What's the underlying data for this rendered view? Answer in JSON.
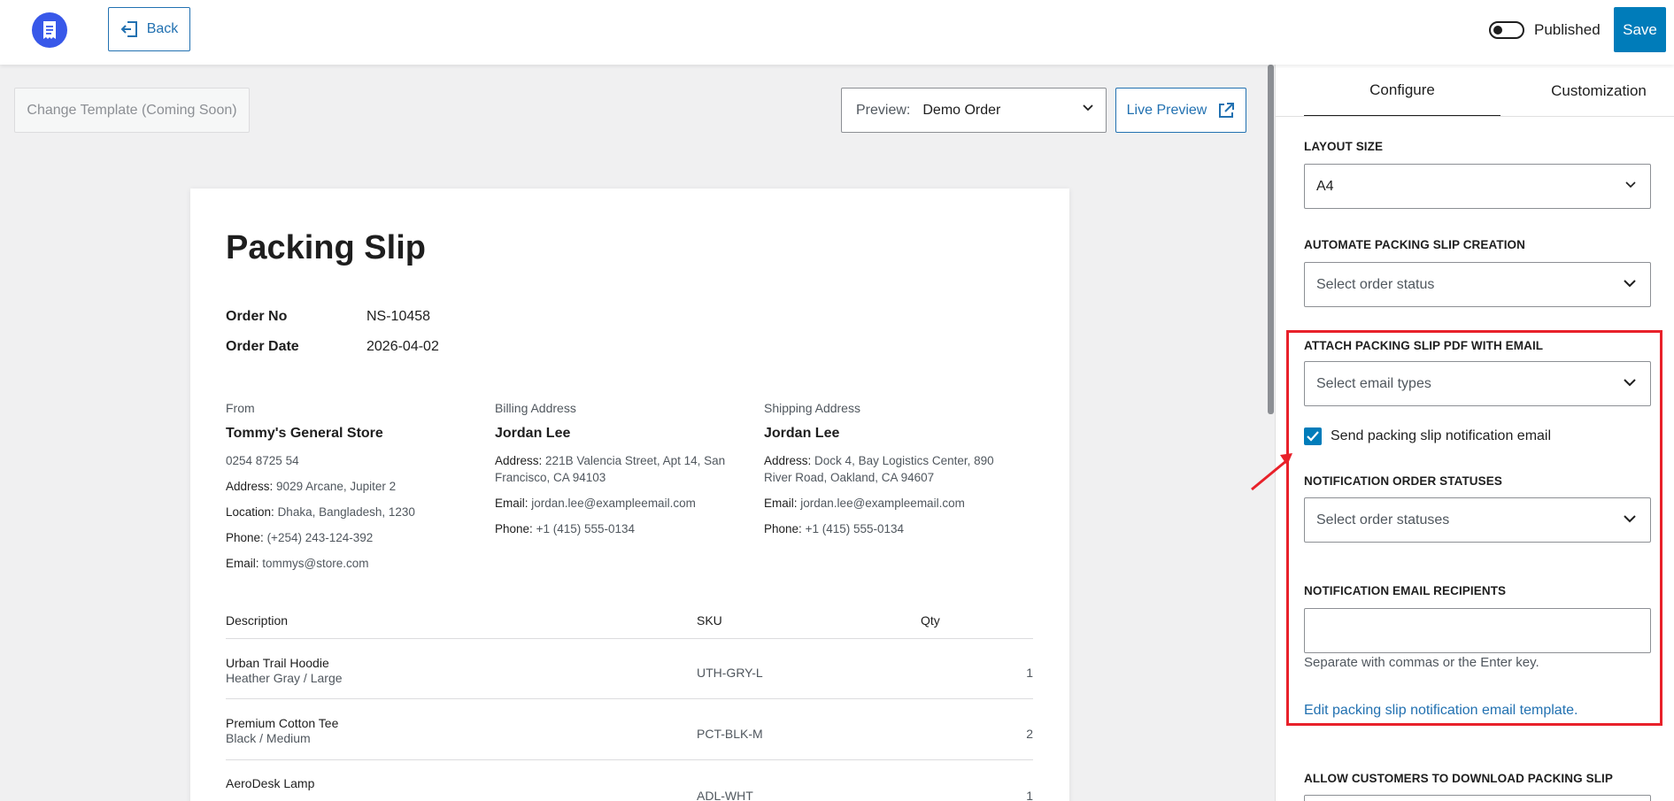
{
  "topbar": {
    "back_label": "Back",
    "status_label": "Published",
    "published": false,
    "save_label": "Save"
  },
  "toolbar": {
    "change_template_label": "Change Template (Coming Soon)",
    "preview_label": "Preview:",
    "preview_value": "Demo Order",
    "live_preview_label": "Live Preview"
  },
  "document": {
    "title": "Packing Slip",
    "order_no_label": "Order No",
    "order_no": "NS-10458",
    "order_date_label": "Order Date",
    "order_date": "2026-04-02",
    "from": {
      "heading": "From",
      "name": "Tommy's General Store",
      "phone_top": "0254 8725 54",
      "address_key": "Address:",
      "address": "9029 Arcane, Jupiter 2",
      "location_key": "Location:",
      "location": "Dhaka, Bangladesh, 1230",
      "phone_key": "Phone:",
      "phone": "(+254) 243-124-392",
      "email_key": "Email:",
      "email": "tommys@store.com"
    },
    "billing": {
      "heading": "Billing Address",
      "name": "Jordan Lee",
      "address_key": "Address:",
      "address": "221B Valencia Street, Apt 14, San Francisco, CA 94103",
      "email_key": "Email:",
      "email": "jordan.lee@exampleemail.com",
      "phone_key": "Phone:",
      "phone": "+1 (415) 555-0134"
    },
    "shipping": {
      "heading": "Shipping Address",
      "name": "Jordan Lee",
      "address_key": "Address:",
      "address": "Dock 4, Bay Logistics Center, 890 River Road, Oakland, CA 94607",
      "email_key": "Email:",
      "email": "jordan.lee@exampleemail.com",
      "phone_key": "Phone:",
      "phone": "+1 (415) 555-0134"
    },
    "table": {
      "headers": [
        "Description",
        "SKU",
        "Qty"
      ],
      "rows": [
        {
          "name": "Urban Trail Hoodie",
          "variant": "Heather Gray / Large",
          "sku": "UTH-GRY-L",
          "qty": "1"
        },
        {
          "name": "Premium Cotton Tee",
          "variant": "Black / Medium",
          "sku": "PCT-BLK-M",
          "qty": "2"
        },
        {
          "name": "AeroDesk Lamp",
          "variant": "",
          "sku": "ADL-WHT",
          "qty": "1"
        }
      ]
    }
  },
  "sidebar": {
    "tabs": [
      {
        "label": "Configure",
        "active": true
      },
      {
        "label": "Customization",
        "active": false
      }
    ],
    "layout_size_label": "Layout Size",
    "layout_size_value": "A4",
    "automate_label": "Automate Packing Slip Creation",
    "automate_placeholder": "Select order status",
    "attach_label": "Attach Packing Slip PDF with Email",
    "attach_placeholder": "Select email types",
    "notify_checkbox_label": "Send packing slip notification email",
    "notify_checked": true,
    "notification_statuses_label": "Notification Order Statuses",
    "notification_statuses_placeholder": "Select order statuses",
    "recipients_label": "Notification Email Recipients",
    "recipients_value": "",
    "recipients_help": "Separate with commas or the Enter key.",
    "edit_template_link": "Edit packing slip notification email template.",
    "allow_download_label": "Allow Customers to Download Packing Slip"
  },
  "colors": {
    "accent": "#007cba",
    "link": "#2271b1",
    "logo": "#3858e9",
    "highlight": "#e8212a"
  }
}
